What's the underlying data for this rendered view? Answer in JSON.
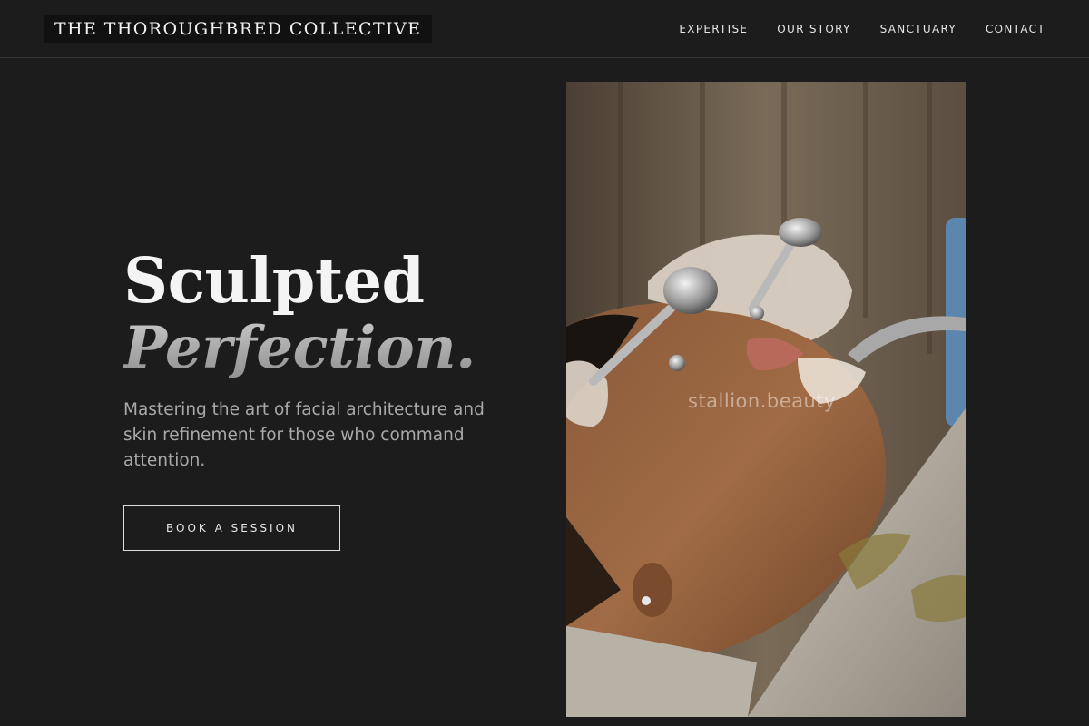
{
  "header": {
    "brand": "THE THOROUGHBRED COLLECTIVE",
    "nav": [
      {
        "label": "EXPERTISE"
      },
      {
        "label": "OUR STORY"
      },
      {
        "label": "SANCTUARY"
      },
      {
        "label": "CONTACT"
      }
    ]
  },
  "hero": {
    "headline_line1": "Sculpted",
    "headline_line2": "Perfection.",
    "subtitle": "Mastering the art of facial architecture and skin refinement for those who command attention.",
    "cta_label": "BOOK A SESSION"
  },
  "image": {
    "description_icon": "facial-treatment-photo",
    "watermark": "stallion.beauty"
  },
  "colors": {
    "background": "#1c1c1c",
    "text_primary": "#f4f4f4",
    "text_secondary": "#a9a9a9"
  }
}
